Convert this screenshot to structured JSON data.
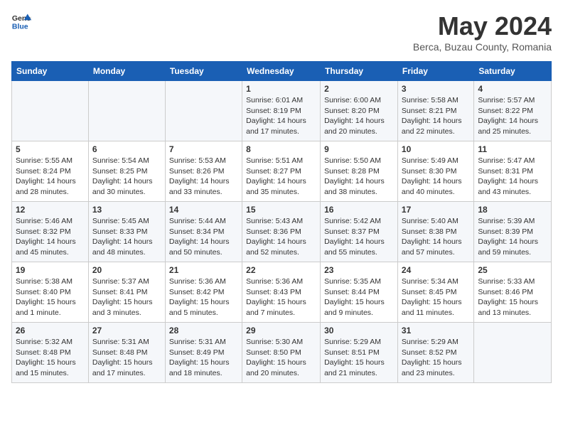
{
  "header": {
    "logo_line1": "General",
    "logo_line2": "Blue",
    "month_title": "May 2024",
    "location": "Berca, Buzau County, Romania"
  },
  "weekdays": [
    "Sunday",
    "Monday",
    "Tuesday",
    "Wednesday",
    "Thursday",
    "Friday",
    "Saturday"
  ],
  "weeks": [
    [
      {
        "day": "",
        "info": ""
      },
      {
        "day": "",
        "info": ""
      },
      {
        "day": "",
        "info": ""
      },
      {
        "day": "1",
        "info": "Sunrise: 6:01 AM\nSunset: 8:19 PM\nDaylight: 14 hours and 17 minutes."
      },
      {
        "day": "2",
        "info": "Sunrise: 6:00 AM\nSunset: 8:20 PM\nDaylight: 14 hours and 20 minutes."
      },
      {
        "day": "3",
        "info": "Sunrise: 5:58 AM\nSunset: 8:21 PM\nDaylight: 14 hours and 22 minutes."
      },
      {
        "day": "4",
        "info": "Sunrise: 5:57 AM\nSunset: 8:22 PM\nDaylight: 14 hours and 25 minutes."
      }
    ],
    [
      {
        "day": "5",
        "info": "Sunrise: 5:55 AM\nSunset: 8:24 PM\nDaylight: 14 hours and 28 minutes."
      },
      {
        "day": "6",
        "info": "Sunrise: 5:54 AM\nSunset: 8:25 PM\nDaylight: 14 hours and 30 minutes."
      },
      {
        "day": "7",
        "info": "Sunrise: 5:53 AM\nSunset: 8:26 PM\nDaylight: 14 hours and 33 minutes."
      },
      {
        "day": "8",
        "info": "Sunrise: 5:51 AM\nSunset: 8:27 PM\nDaylight: 14 hours and 35 minutes."
      },
      {
        "day": "9",
        "info": "Sunrise: 5:50 AM\nSunset: 8:28 PM\nDaylight: 14 hours and 38 minutes."
      },
      {
        "day": "10",
        "info": "Sunrise: 5:49 AM\nSunset: 8:30 PM\nDaylight: 14 hours and 40 minutes."
      },
      {
        "day": "11",
        "info": "Sunrise: 5:47 AM\nSunset: 8:31 PM\nDaylight: 14 hours and 43 minutes."
      }
    ],
    [
      {
        "day": "12",
        "info": "Sunrise: 5:46 AM\nSunset: 8:32 PM\nDaylight: 14 hours and 45 minutes."
      },
      {
        "day": "13",
        "info": "Sunrise: 5:45 AM\nSunset: 8:33 PM\nDaylight: 14 hours and 48 minutes."
      },
      {
        "day": "14",
        "info": "Sunrise: 5:44 AM\nSunset: 8:34 PM\nDaylight: 14 hours and 50 minutes."
      },
      {
        "day": "15",
        "info": "Sunrise: 5:43 AM\nSunset: 8:36 PM\nDaylight: 14 hours and 52 minutes."
      },
      {
        "day": "16",
        "info": "Sunrise: 5:42 AM\nSunset: 8:37 PM\nDaylight: 14 hours and 55 minutes."
      },
      {
        "day": "17",
        "info": "Sunrise: 5:40 AM\nSunset: 8:38 PM\nDaylight: 14 hours and 57 minutes."
      },
      {
        "day": "18",
        "info": "Sunrise: 5:39 AM\nSunset: 8:39 PM\nDaylight: 14 hours and 59 minutes."
      }
    ],
    [
      {
        "day": "19",
        "info": "Sunrise: 5:38 AM\nSunset: 8:40 PM\nDaylight: 15 hours and 1 minute."
      },
      {
        "day": "20",
        "info": "Sunrise: 5:37 AM\nSunset: 8:41 PM\nDaylight: 15 hours and 3 minutes."
      },
      {
        "day": "21",
        "info": "Sunrise: 5:36 AM\nSunset: 8:42 PM\nDaylight: 15 hours and 5 minutes."
      },
      {
        "day": "22",
        "info": "Sunrise: 5:36 AM\nSunset: 8:43 PM\nDaylight: 15 hours and 7 minutes."
      },
      {
        "day": "23",
        "info": "Sunrise: 5:35 AM\nSunset: 8:44 PM\nDaylight: 15 hours and 9 minutes."
      },
      {
        "day": "24",
        "info": "Sunrise: 5:34 AM\nSunset: 8:45 PM\nDaylight: 15 hours and 11 minutes."
      },
      {
        "day": "25",
        "info": "Sunrise: 5:33 AM\nSunset: 8:46 PM\nDaylight: 15 hours and 13 minutes."
      }
    ],
    [
      {
        "day": "26",
        "info": "Sunrise: 5:32 AM\nSunset: 8:48 PM\nDaylight: 15 hours and 15 minutes."
      },
      {
        "day": "27",
        "info": "Sunrise: 5:31 AM\nSunset: 8:48 PM\nDaylight: 15 hours and 17 minutes."
      },
      {
        "day": "28",
        "info": "Sunrise: 5:31 AM\nSunset: 8:49 PM\nDaylight: 15 hours and 18 minutes."
      },
      {
        "day": "29",
        "info": "Sunrise: 5:30 AM\nSunset: 8:50 PM\nDaylight: 15 hours and 20 minutes."
      },
      {
        "day": "30",
        "info": "Sunrise: 5:29 AM\nSunset: 8:51 PM\nDaylight: 15 hours and 21 minutes."
      },
      {
        "day": "31",
        "info": "Sunrise: 5:29 AM\nSunset: 8:52 PM\nDaylight: 15 hours and 23 minutes."
      },
      {
        "day": "",
        "info": ""
      }
    ]
  ]
}
